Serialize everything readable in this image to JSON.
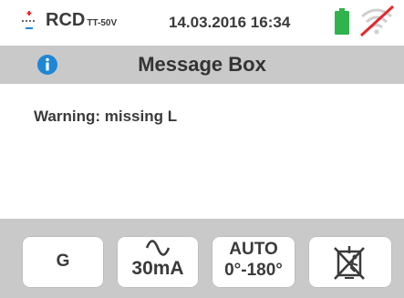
{
  "status_bar": {
    "mode": "RCD",
    "mode_sub": "TT-50V",
    "datetime": "14.03.2016  16:34",
    "battery_icon": "battery-full-icon",
    "wifi_icon": "wifi-disabled-icon",
    "battery_color": "#2fb34a",
    "wifi_slash_color": "#e0282e"
  },
  "title_bar": {
    "info_icon": "info-icon",
    "title": "Message Box",
    "info_color": "#1f86d6"
  },
  "message": "Warning: missing L",
  "softkeys": {
    "g_label": "G",
    "current_label": "30mA",
    "current_icon": "ac-wave-icon",
    "auto_line1": "AUTO",
    "auto_line2": "0°-180°",
    "contact_icon": "touch-contact-disabled-icon"
  },
  "colors": {
    "panel_gray": "#c9c9c9",
    "text": "#3a3a3a"
  }
}
